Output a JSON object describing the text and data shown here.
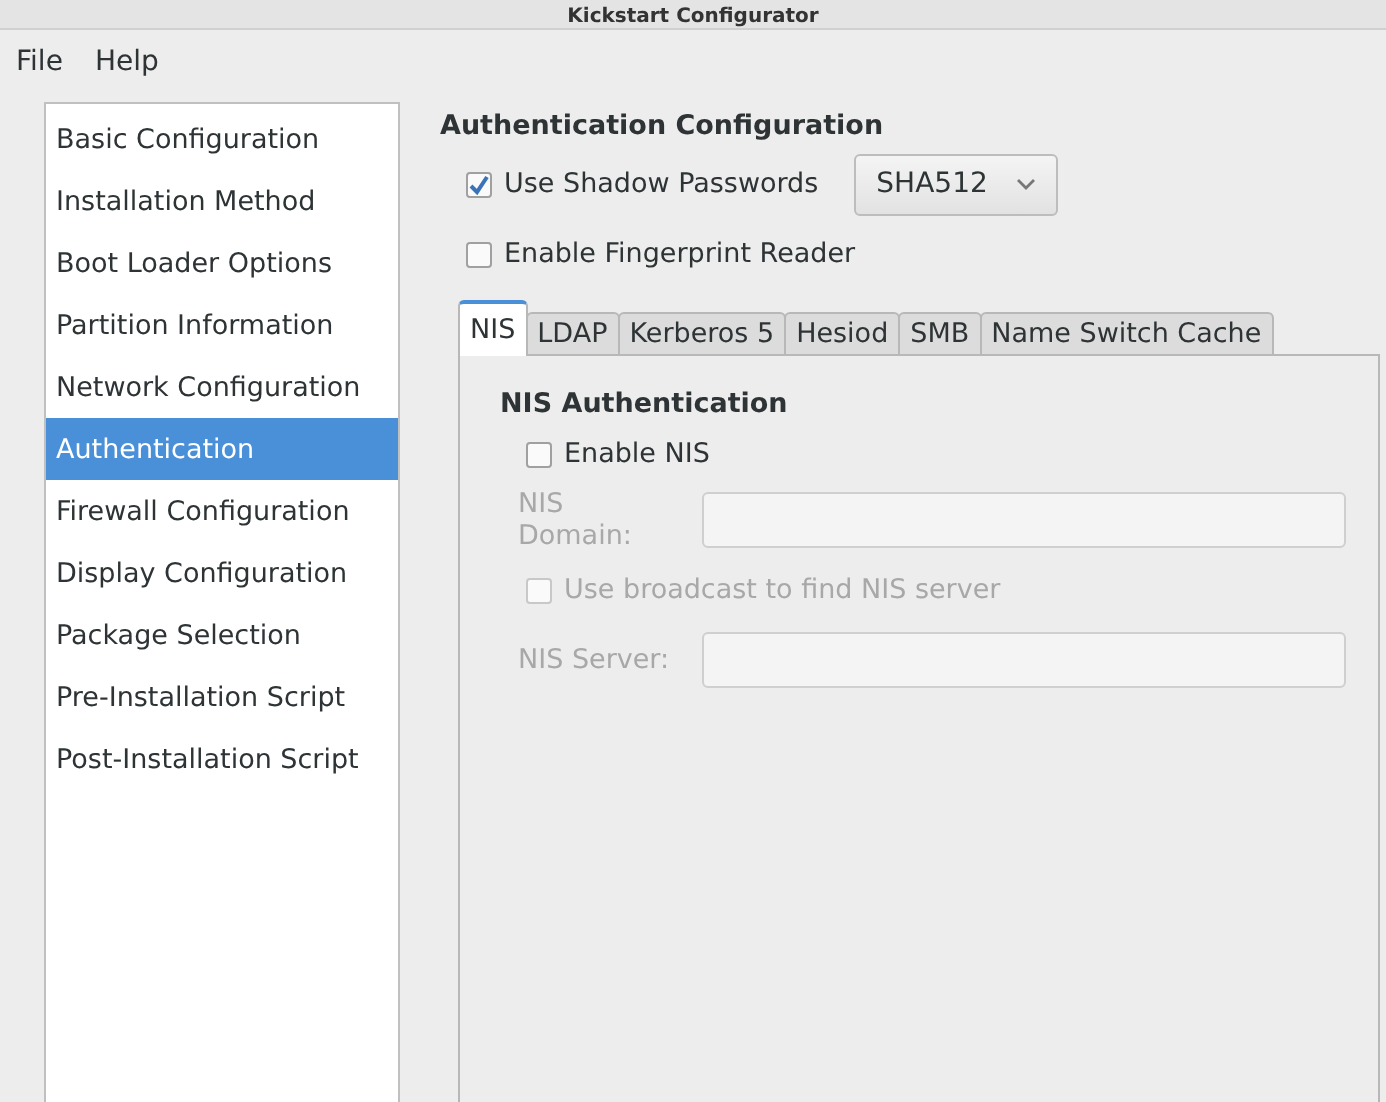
{
  "window": {
    "title": "Kickstart Configurator"
  },
  "menu": [
    "File",
    "Help"
  ],
  "sidebar": {
    "items": [
      {
        "label": "Basic Configuration",
        "selected": false
      },
      {
        "label": "Installation Method",
        "selected": false
      },
      {
        "label": "Boot Loader Options",
        "selected": false
      },
      {
        "label": "Partition Information",
        "selected": false
      },
      {
        "label": "Network Configuration",
        "selected": false
      },
      {
        "label": "Authentication",
        "selected": true
      },
      {
        "label": "Firewall Configuration",
        "selected": false
      },
      {
        "label": "Display Configuration",
        "selected": false
      },
      {
        "label": "Package Selection",
        "selected": false
      },
      {
        "label": "Pre-Installation Script",
        "selected": false
      },
      {
        "label": "Post-Installation Script",
        "selected": false
      }
    ]
  },
  "section_title": "Authentication Configuration",
  "shadow": {
    "label": "Use Shadow Passwords",
    "checked": true,
    "algorithm": "SHA512"
  },
  "fingerprint": {
    "label": "Enable Fingerprint Reader",
    "checked": false
  },
  "tabs": [
    {
      "label": "NIS",
      "selected": true
    },
    {
      "label": "LDAP",
      "selected": false
    },
    {
      "label": "Kerberos 5",
      "selected": false
    },
    {
      "label": "Hesiod",
      "selected": false
    },
    {
      "label": "SMB",
      "selected": false
    },
    {
      "label": "Name Switch Cache",
      "selected": false
    }
  ],
  "nis": {
    "title": "NIS Authentication",
    "enable": {
      "label": "Enable NIS",
      "checked": false
    },
    "domain": {
      "label": "NIS Domain:",
      "disabled": true
    },
    "broadcast": {
      "label": "Use broadcast to find NIS server",
      "checked": false,
      "disabled": true
    },
    "server": {
      "label": "NIS Server:",
      "disabled": true
    }
  }
}
